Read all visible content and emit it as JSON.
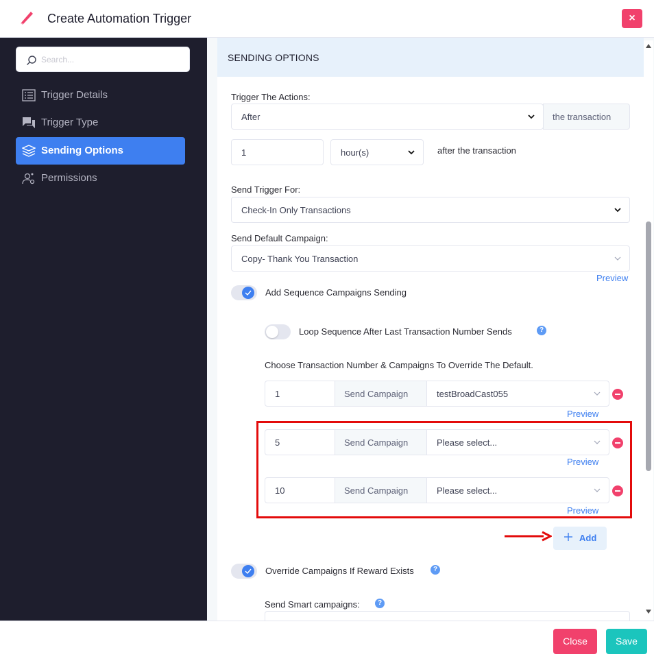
{
  "header": {
    "title": "Create Automation Trigger",
    "close_symbol": "×"
  },
  "sidebar": {
    "search_placeholder": "Search...",
    "items": [
      {
        "label": "Trigger Details",
        "icon": "list-icon",
        "active": false
      },
      {
        "label": "Trigger Type",
        "icon": "chat-icon",
        "active": false
      },
      {
        "label": "Sending Options",
        "icon": "layers-icon",
        "active": true
      },
      {
        "label": "Permissions",
        "icon": "user-gear-icon",
        "active": false
      }
    ]
  },
  "section": {
    "title": "SENDING OPTIONS"
  },
  "form": {
    "trigger_label": "Trigger The Actions:",
    "trigger_timing": "After",
    "trigger_addon": "the transaction",
    "delay_value": "1",
    "delay_unit": "hour(s)",
    "delay_suffix": "after the transaction",
    "send_for_label": "Send Trigger For:",
    "send_for_value": "Check-In Only Transactions",
    "default_campaign_label": "Send Default Campaign:",
    "default_campaign_value": "Copy- Thank You Transaction",
    "preview": "Preview",
    "sequence_toggle_label": "Add Sequence Campaigns Sending",
    "loop_toggle_label": "Loop Sequence After Last Transaction Number Sends",
    "choose_label": "Choose Transaction Number & Campaigns To Override The Default.",
    "sequence_rows": [
      {
        "number": "1",
        "addon": "Send Campaign",
        "campaign": "testBroadCast055",
        "preview": "Preview"
      },
      {
        "number": "5",
        "addon": "Send Campaign",
        "campaign": "Please select...",
        "preview": "Preview"
      },
      {
        "number": "10",
        "addon": "Send Campaign",
        "campaign": "Please select...",
        "preview": "Preview"
      }
    ],
    "add_label": "Add",
    "override_toggle_label": "Override Campaigns If Reward Exists",
    "smart_label": "Send Smart campaigns:",
    "help_symbol": "?"
  },
  "footer": {
    "close_label": "Close",
    "save_label": "Save"
  },
  "colors": {
    "accent": "#3e7ff0",
    "danger": "#f1416c",
    "success": "#1bc5bd",
    "sidebar": "#1e1e2d",
    "highlight": "#e30b0b"
  }
}
